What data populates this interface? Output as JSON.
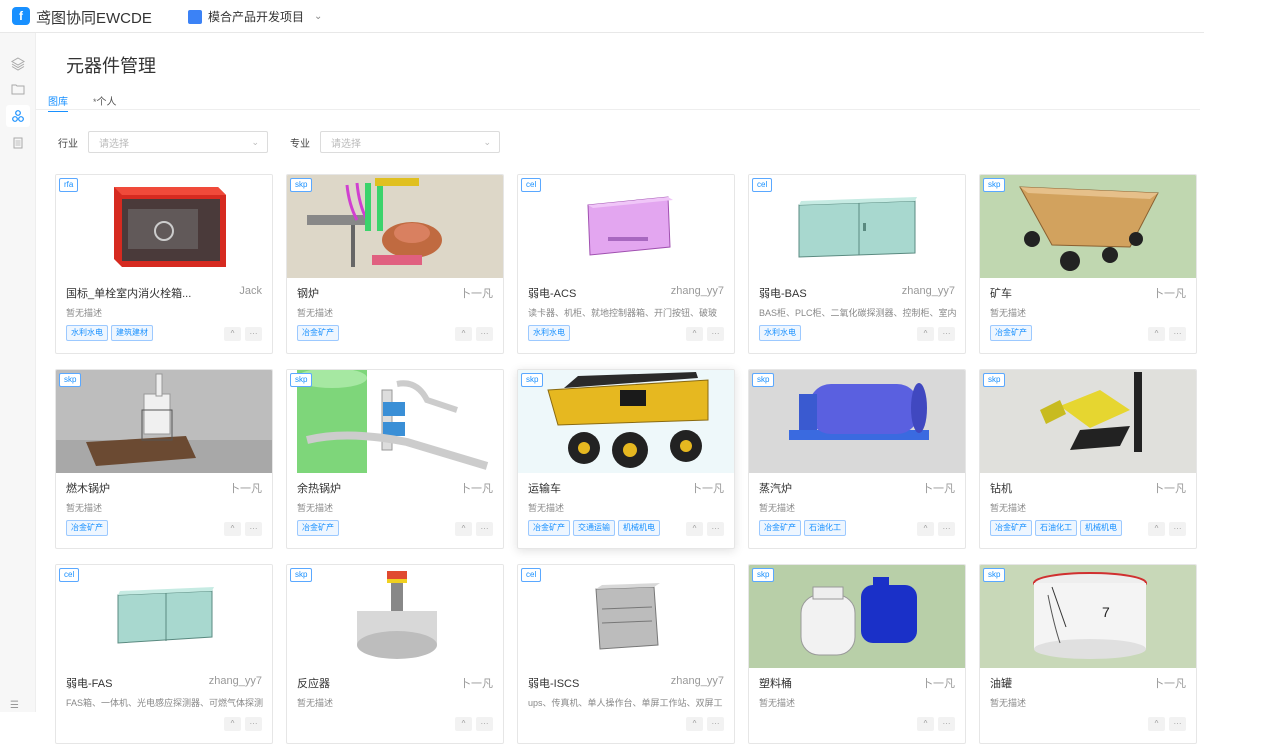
{
  "app": {
    "logo": "f",
    "title": "鸢图协同EWCDE"
  },
  "project": {
    "name": "模合产品开发项目"
  },
  "page": {
    "title": "元器件管理"
  },
  "tabs": [
    {
      "label": "图库"
    },
    {
      "label": "个人"
    }
  ],
  "filters": {
    "industry": {
      "label": "行业",
      "placeholder": "请选择"
    },
    "specialty": {
      "label": "专业",
      "placeholder": "请选择"
    }
  },
  "cards": [
    {
      "badge": "rfa",
      "name": "国标_单栓室内消火栓箱...",
      "author": "Jack",
      "desc": "暂无描述",
      "tags": [
        "水利水电",
        "建筑建材"
      ]
    },
    {
      "badge": "skp",
      "name": "钢炉",
      "author": "卜一凡",
      "desc": "暂无描述",
      "tags": [
        "冶金矿产"
      ]
    },
    {
      "badge": "cel",
      "name": "弱电-ACS",
      "author": "zhang_yy7",
      "desc": "读卡器、机柜、就地控制器箱、开门按钮、破玻",
      "tags": [
        "水利水电"
      ]
    },
    {
      "badge": "cel",
      "name": "弱电-BAS",
      "author": "zhang_yy7",
      "desc": "BAS柜、PLC柜、二氧化碳探测器、控制柜、室内",
      "tags": [
        "水利水电"
      ]
    },
    {
      "badge": "skp",
      "name": "矿车",
      "author": "卜一凡",
      "desc": "暂无描述",
      "tags": [
        "冶金矿产"
      ]
    },
    {
      "badge": "skp",
      "name": "燃木锅炉",
      "author": "卜一凡",
      "desc": "暂无描述",
      "tags": [
        "冶金矿产"
      ]
    },
    {
      "badge": "skp",
      "name": "余热锅炉",
      "author": "卜一凡",
      "desc": "暂无描述",
      "tags": [
        "冶金矿产"
      ]
    },
    {
      "badge": "skp",
      "name": "运输车",
      "author": "卜一凡",
      "desc": "暂无描述",
      "tags": [
        "冶金矿产",
        "交通运输",
        "机械机电"
      ]
    },
    {
      "badge": "skp",
      "name": "蒸汽炉",
      "author": "卜一凡",
      "desc": "暂无描述",
      "tags": [
        "冶金矿产",
        "石油化工"
      ]
    },
    {
      "badge": "skp",
      "name": "钻机",
      "author": "卜一凡",
      "desc": "暂无描述",
      "tags": [
        "冶金矿产",
        "石油化工",
        "机械机电"
      ]
    },
    {
      "badge": "cel",
      "name": "弱电-FAS",
      "author": "zhang_yy7",
      "desc": "FAS箱、一体机、光电感应探测器、可燃气体探测",
      "tags": []
    },
    {
      "badge": "skp",
      "name": "反应器",
      "author": "卜一凡",
      "desc": "暂无描述",
      "tags": []
    },
    {
      "badge": "cel",
      "name": "弱电-ISCS",
      "author": "zhang_yy7",
      "desc": "ups、传真机、单人操作台、单屏工作站、双屏工",
      "tags": []
    },
    {
      "badge": "skp",
      "name": "塑料桶",
      "author": "卜一凡",
      "desc": "暂无描述",
      "tags": []
    },
    {
      "badge": "skp",
      "name": "油罐",
      "author": "卜一凡",
      "desc": "暂无描述",
      "tags": []
    }
  ],
  "card_actions": {
    "collapse": "^",
    "more": "···"
  },
  "colors": {
    "accent": "#1890ff"
  }
}
